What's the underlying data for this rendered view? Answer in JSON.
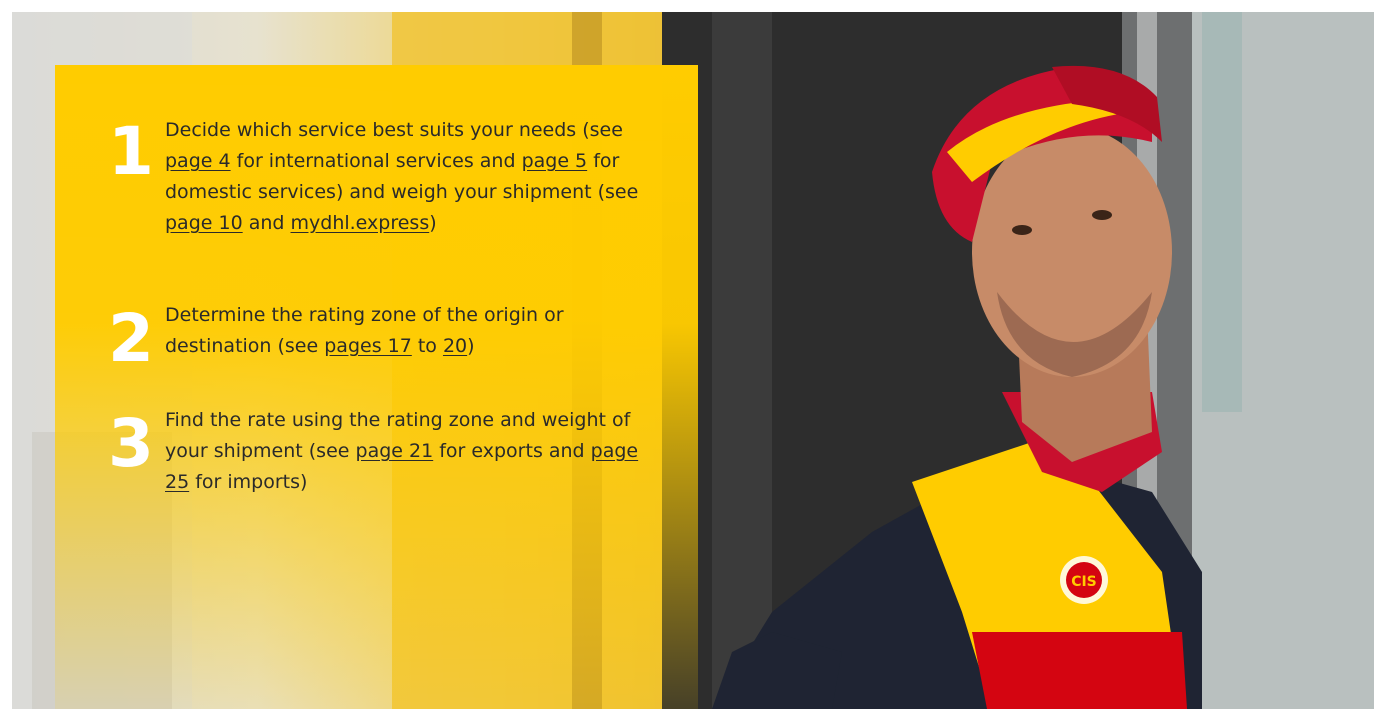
{
  "colors": {
    "panel_yellow": "#FFCC00",
    "number_white": "#FFFFFF",
    "text_dark": "#2A2A2A",
    "uniform_red": "#D40511"
  },
  "photo": {
    "subject": "DHL courier in red cap and yellow-red polo looking out of a delivery van window",
    "badge_text": "CIS"
  },
  "steps": [
    {
      "number": "1",
      "parts": [
        "Decide which service best suits your needs (see ",
        "page 4",
        " for international services and ",
        "page 5",
        " for domestic services) and weigh your shipment (see ",
        "page 10",
        " and ",
        "mydhl.express",
        ")"
      ]
    },
    {
      "number": "2",
      "parts": [
        "Determine the rating zone of the origin or destination (see ",
        "pages 17",
        " to ",
        "20",
        ")"
      ]
    },
    {
      "number": "3",
      "parts": [
        "Find the rate using the rating zone and weight of your shipment (see ",
        "page 21",
        " for exports and ",
        "page 25",
        " for imports)"
      ]
    }
  ]
}
